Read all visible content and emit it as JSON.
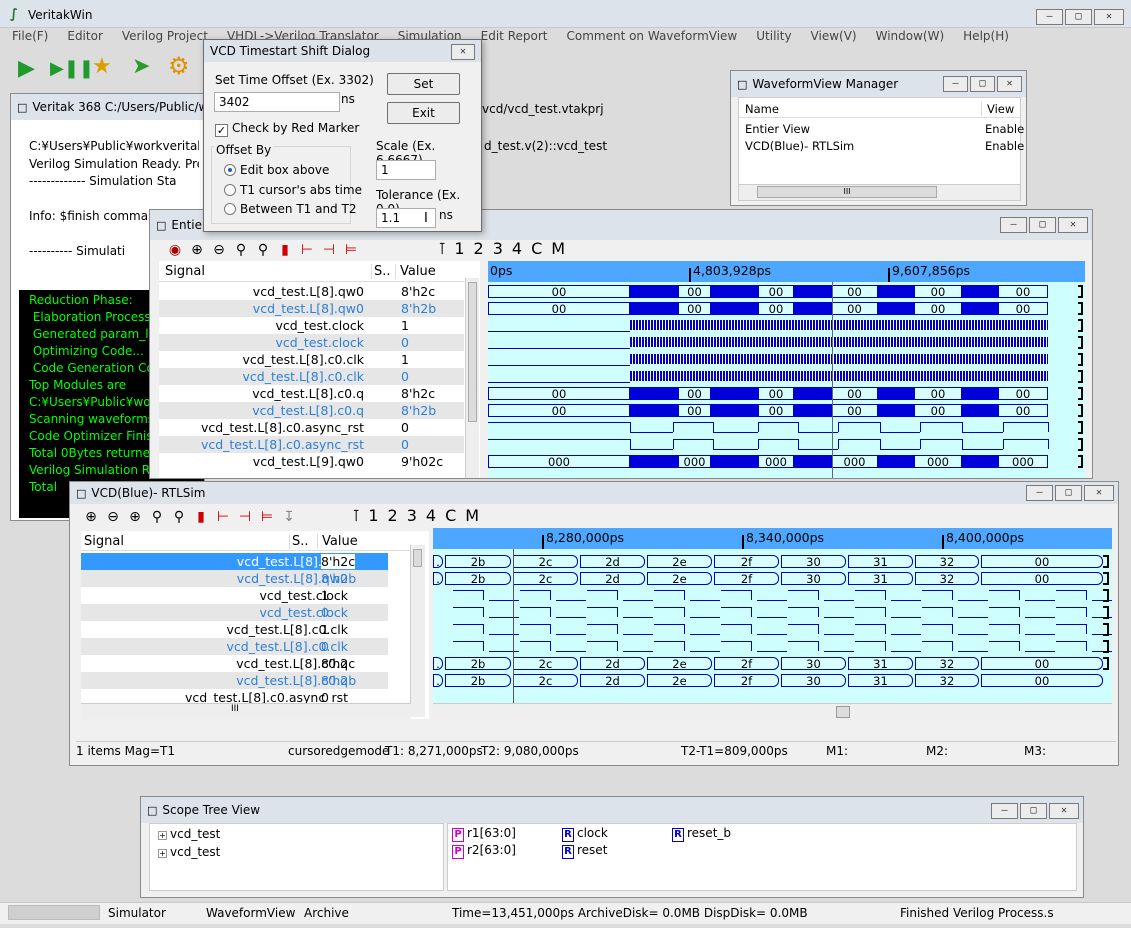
{
  "app": {
    "title": "VeritakWin",
    "menu": [
      "File(F)",
      "Editor",
      "Verilog Project",
      "VHDL->Verilog Translator",
      "Simulation",
      "Edit Report",
      "Comment on WaveformView",
      "Utility",
      "View(V)",
      "Window(W)",
      "Help(H)"
    ]
  },
  "console": {
    "title": "Veritak 368 C:/Users/Public/wo",
    "title_right": "vcd/vcd_test.vtakprj",
    "lines": [
      "C:¥Users¥Public¥workveritakwi",
      "Verilog Simulation Ready. Press",
      "------------- Simulation Sta",
      "",
      "Info: $finish command",
      "",
      "---------- Simulati"
    ],
    "right_line": "d_test.v(2)::vcd_test",
    "log": [
      "Reduction Phase:",
      " Elaboration Process",
      " Generated param_list",
      " Optimizing Code...",
      " Code Generation Co",
      "Top Modules are",
      "C:¥Users¥Public¥work",
      "Scanning waveforms",
      "Code Optimizer Finish",
      "Total 0Bytes returne",
      "Verilog Simulation Re",
      "Total"
    ]
  },
  "dialog": {
    "title": "VCD Timestart Shift Dialog",
    "offset_label": "Set Time Offset  (Ex. 3302)",
    "offset_value": "3402",
    "offset_unit": "ns",
    "set": "Set",
    "exit": "Exit",
    "check_label": "Check by Red Marker",
    "offset_by": "Offset By",
    "radios": [
      "Edit box above",
      "T1 cursor's abs time",
      "Between T1 and T2"
    ],
    "scale_label": "Scale  (Ex. 6.6667)",
    "scale_value": "1",
    "tol_label": "Tolerance (Ex. 0.0)",
    "tol_value": "1.1",
    "tol_unit": "ns"
  },
  "manager": {
    "title": "WaveformView Manager",
    "col_name": "Name",
    "col_view": "View",
    "rows": [
      {
        "name": "Entier View",
        "view": "Enable"
      },
      {
        "name": "VCD(Blue)- RTLSim",
        "view": "Enable"
      }
    ],
    "scroll": "III"
  },
  "entier": {
    "title": "Entie",
    "hdr": {
      "signal": "Signal",
      "s": "S..",
      "value": "Value"
    },
    "times": [
      "0ps",
      "4,803,928ps",
      "9,607,856ps"
    ],
    "toolbar_nums": [
      "1",
      "2",
      "3",
      "4",
      "C",
      "M"
    ],
    "rows": [
      {
        "name": "vcd_test.L[8].qw0",
        "val": "8'h2c",
        "blue": false,
        "bus": "00"
      },
      {
        "name": "vcd_test.L[8].qw0",
        "val": "8'h2b",
        "blue": true,
        "bus": "00"
      },
      {
        "name": "vcd_test.clock",
        "val": "1",
        "blue": false
      },
      {
        "name": "vcd_test.clock",
        "val": "0",
        "blue": true
      },
      {
        "name": "vcd_test.L[8].c0.clk",
        "val": "1",
        "blue": false
      },
      {
        "name": "vcd_test.L[8].c0.clk",
        "val": "0",
        "blue": true
      },
      {
        "name": "vcd_test.L[8].c0.q",
        "val": "8'h2c",
        "blue": false,
        "bus": "00"
      },
      {
        "name": "vcd_test.L[8].c0.q",
        "val": "8'h2b",
        "blue": true,
        "bus": "00"
      },
      {
        "name": "vcd_test.L[8].c0.async_rst",
        "val": "0",
        "blue": false
      },
      {
        "name": "vcd_test.L[8].c0.async_rst",
        "val": "0",
        "blue": true
      },
      {
        "name": "vcd_test.L[9].qw0",
        "val": "9'h02c",
        "blue": false,
        "bus": "000"
      }
    ]
  },
  "rtl": {
    "title": "VCD(Blue)- RTLSim",
    "hdr": {
      "signal": "Signal",
      "s": "S..",
      "value": "Value"
    },
    "times": [
      "8,280,000ps",
      "8,340,000ps",
      "8,400,000ps"
    ],
    "bus_vals": [
      "2b",
      "2c",
      "2d",
      "2e",
      "2f",
      "30",
      "31",
      "32",
      "00"
    ],
    "bus_first": ".",
    "rows": [
      {
        "name": "vcd_test.L[8].qw0",
        "val": "8'h2c",
        "blue": false,
        "sel": true
      },
      {
        "name": "vcd_test.L[8].qw0",
        "val": "8'h2b",
        "blue": true
      },
      {
        "name": "vcd_test.clock",
        "val": "1",
        "blue": false
      },
      {
        "name": "vcd_test.clock",
        "val": "0",
        "blue": true
      },
      {
        "name": "vcd_test.L[8].c0.clk",
        "val": "1",
        "blue": false
      },
      {
        "name": "vcd_test.L[8].c0.clk",
        "val": "0",
        "blue": true
      },
      {
        "name": "vcd_test.L[8].c0.q",
        "val": "8'h2c",
        "blue": false
      },
      {
        "name": "vcd_test.L[8].c0.q",
        "val": "8'h2b",
        "blue": true
      },
      {
        "name": "vcd_test.L[8].c0.async_rst",
        "val": "0",
        "blue": false
      },
      {
        "name": "vcd_test.L[8].c0.async_rst",
        "val": "0",
        "blue": true
      }
    ],
    "status": [
      "1 items  Mag=T1",
      "cursoredgemode",
      "T1: 8,271,000ps",
      "T2: 9,080,000ps",
      "T2-T1=809,000ps",
      "M1:",
      "M2:",
      "M3:"
    ],
    "scroll": "III",
    "toolbar_nums": [
      "1",
      "2",
      "3",
      "4",
      "C",
      "M"
    ]
  },
  "scope": {
    "title": "Scope Tree View",
    "tree": [
      "vcd_test",
      "vcd_test"
    ],
    "regs": [
      {
        "type": "P",
        "name": "r1[63:0]"
      },
      {
        "type": "P",
        "name": "r2[63:0]"
      }
    ],
    "ports": [
      {
        "type": "R",
        "name": "clock"
      },
      {
        "type": "R",
        "name": "reset"
      },
      {
        "type": "R",
        "name": "reset_b"
      }
    ]
  },
  "statusbar": [
    "Simulator",
    "WaveformView",
    "Archive",
    "Time=13,451,000ps ArchiveDisk=  0.0MB DispDisk=  0.0MB",
    "Finished Verilog Process.s"
  ],
  "colors": {
    "blue": "#2c7fd8",
    "wave_bg": "#cefefe",
    "console_green": "#00ff00"
  }
}
